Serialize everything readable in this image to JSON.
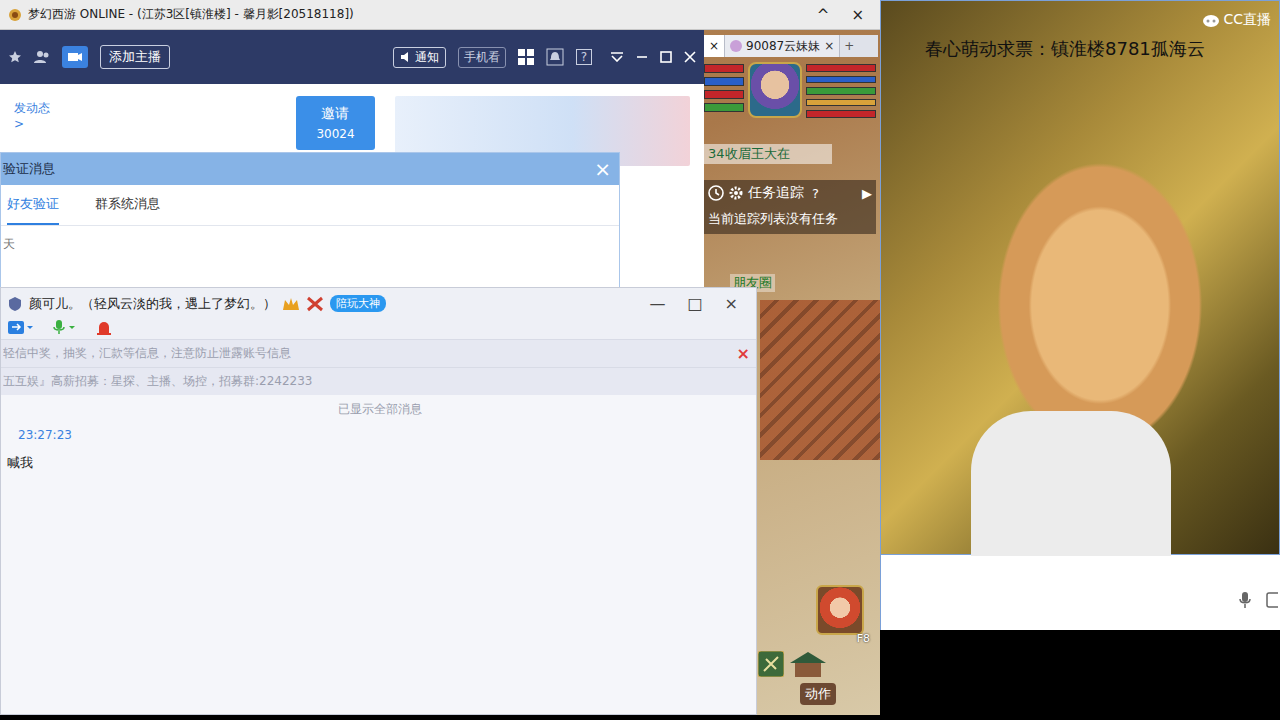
{
  "game_window": {
    "title": "梦幻西游 ONLINE - (江苏3区[镇淮楼] - 馨月影[20518118])",
    "controls": [
      "^",
      "×"
    ]
  },
  "browser_tabs": [
    {
      "label": "×",
      "selected": true
    },
    {
      "label": "90087云妹妹",
      "close": "×",
      "selected": false
    }
  ],
  "new_tab": "+",
  "hud": {
    "npc_label": "34收眉王大在",
    "tracker_title": "任务追踪",
    "tracker_help": "?",
    "tracker_arrow": "▶",
    "tracker_empty": "当前追踪列表没有任务",
    "circle_label": "朋友圈",
    "hotkey": "F8",
    "action": "动作"
  },
  "cc_client": {
    "add_button": "添加主播",
    "notify": "通知",
    "mobile": "手机看",
    "help": "?",
    "post_link": "发动态>",
    "invite": {
      "label": "邀请",
      "count": "30024"
    }
  },
  "verify_dialog": {
    "title": "验证消息",
    "close": "×",
    "tabs": [
      {
        "label": "好友验证",
        "selected": true
      },
      {
        "label": "群系统消息",
        "selected": false
      }
    ],
    "date_label": "天"
  },
  "chat_window": {
    "title": "颜可儿。（轻风云淡的我，遇上了梦幻。）",
    "badge": "陪玩大神",
    "controls": [
      "—",
      "□",
      "×"
    ],
    "notices": [
      {
        "text": "轻信中奖，抽奖，汇款等信息，注意防止泄露账号信息",
        "closable": true,
        "close": "×"
      },
      {
        "text": "五互娱』高薪招募：星探、主播、场控，招募群:2242233",
        "closable": false,
        "close": ""
      }
    ],
    "history_note": "已显示全部消息",
    "messages": [
      {
        "time": "23:27:23",
        "text": "喊我"
      }
    ]
  },
  "stream": {
    "overlay": "春心萌动求票：镇淮楼8781孤海云",
    "logo": "CC直播"
  }
}
